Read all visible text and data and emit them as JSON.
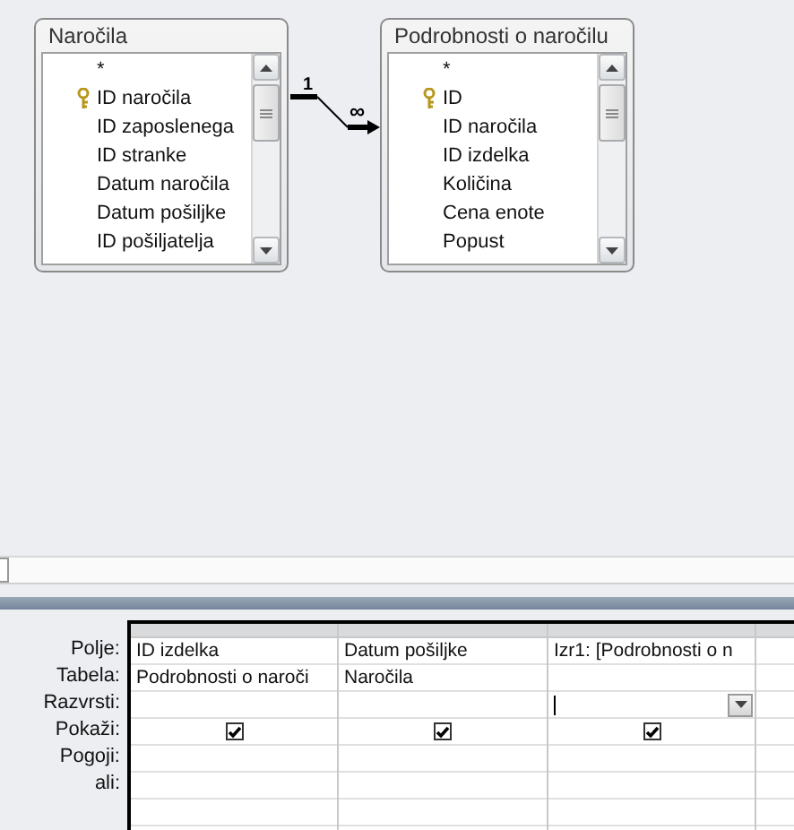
{
  "tables": [
    {
      "title": "Naročila",
      "fields": [
        {
          "name": "*",
          "primary_key": false
        },
        {
          "name": "ID naročila",
          "primary_key": true
        },
        {
          "name": "ID zaposlenega",
          "primary_key": false
        },
        {
          "name": "ID stranke",
          "primary_key": false
        },
        {
          "name": "Datum naročila",
          "primary_key": false
        },
        {
          "name": "Datum pošiljke",
          "primary_key": false
        },
        {
          "name": "ID pošiljatelja",
          "primary_key": false
        }
      ]
    },
    {
      "title": "Podrobnosti o naročilu",
      "fields": [
        {
          "name": "*",
          "primary_key": false
        },
        {
          "name": "ID",
          "primary_key": true
        },
        {
          "name": "ID naročila",
          "primary_key": false
        },
        {
          "name": "ID izdelka",
          "primary_key": false
        },
        {
          "name": "Količina",
          "primary_key": false
        },
        {
          "name": "Cena enote",
          "primary_key": false
        },
        {
          "name": "Popust",
          "primary_key": false
        }
      ]
    }
  ],
  "relationship": {
    "one_label": "1",
    "many_label": "∞"
  },
  "grid": {
    "row_labels": [
      "Polje:",
      "Tabela:",
      "Razvrsti:",
      "Pokaži:",
      "Pogoji:",
      "ali:"
    ],
    "columns": [
      {
        "field": "ID izdelka",
        "table": "Podrobnosti o naroči",
        "show": true,
        "active": false
      },
      {
        "field": "Datum pošiljke",
        "table": "Naročila",
        "show": true,
        "active": false
      },
      {
        "field": "Izr1: [Podrobnosti o n",
        "show": true,
        "active": true
      }
    ]
  }
}
